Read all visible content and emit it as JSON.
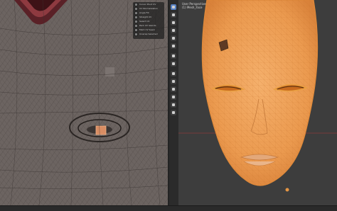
{
  "uv_editor": {
    "overlay_options": [
      {
        "label": "Cursor Pivot UV"
      },
      {
        "label": "UV Normalization"
      },
      {
        "label": "Angle Fill"
      },
      {
        "label": "Straight UV"
      },
      {
        "label": "Select UV"
      },
      {
        "label": "Pack UV Islands"
      },
      {
        "label": "Mark UV Seam"
      },
      {
        "label": "Unwrap Selected"
      }
    ]
  },
  "viewport": {
    "view_name": "User Perspective",
    "object_label": "(1) Mesh_Face"
  },
  "status_bar": {
    "left": "",
    "right": ""
  },
  "colors": {
    "mesh_orange": "#f2a454",
    "wire_orange": "#d17d2f",
    "uv_background": "#6c6461",
    "active_tool": "#5680c2",
    "status_dot": "#d44a3a"
  }
}
